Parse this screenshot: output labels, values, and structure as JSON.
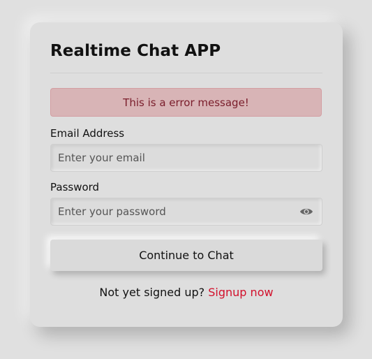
{
  "app": {
    "title": "Realtime Chat APP"
  },
  "error": {
    "message": "This is a error message!"
  },
  "form": {
    "email_label": "Email Address",
    "email_placeholder": "Enter your email",
    "email_value": "",
    "password_label": "Password",
    "password_placeholder": "Enter your password",
    "password_value": "",
    "submit_label": "Continue to Chat"
  },
  "footer": {
    "prompt": "Not yet signed up?",
    "signup_link": "Signup now"
  },
  "icons": {
    "password_toggle": "eye-icon"
  },
  "colors": {
    "background": "#e0e0e0",
    "error_bg": "#d8b4b6",
    "error_text": "#7a1d2b",
    "link": "#d2102b"
  }
}
